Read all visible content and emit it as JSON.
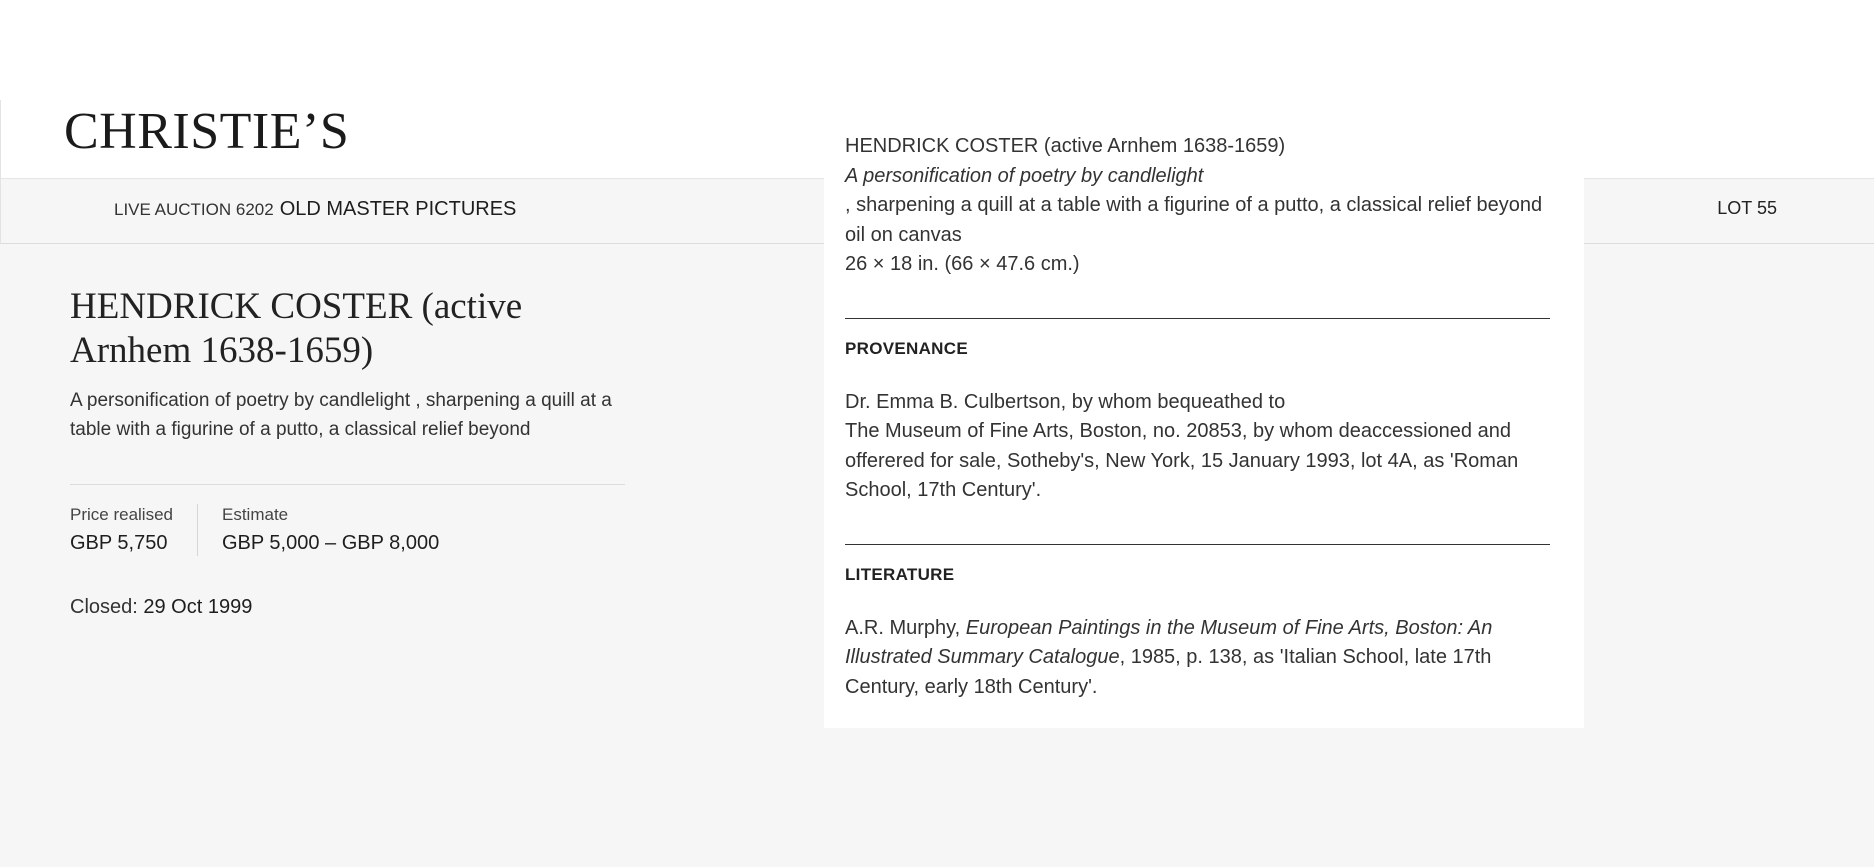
{
  "brand": {
    "logo_text": "CHRISTIE’S"
  },
  "sale": {
    "type_label": "LIVE AUCTION 6202",
    "title": "OLD MASTER PICTURES",
    "lot": "LOT 55"
  },
  "lot": {
    "artist_title": "HENDRICK COSTER (active Arnhem 1638-1659)",
    "subtitle": "A personification of poetry by candlelight , sharpening a quill at a table with a figurine of a putto, a classical relief beyond",
    "price_realised_label": "Price realised",
    "price_realised": "GBP 5,750",
    "estimate_label": "Estimate",
    "estimate": "GBP 5,000 – GBP 8,000",
    "closed_label": "Closed:",
    "closed_date": "29 Oct 1999"
  },
  "details": {
    "artist_line": "HENDRICK COSTER (active Arnhem 1638-1659)",
    "title_italic": "A personification of poetry by candlelight",
    "title_rest": ", sharpening a quill at a table with a figurine of a putto, a classical relief beyond",
    "medium": "oil on canvas",
    "dimensions": "26 × 18 in. (66 × 47.6 cm.)",
    "provenance_heading": "PROVENANCE",
    "provenance_line_1": "Dr. Emma B. Culbertson, by whom bequeathed to",
    "provenance_line_2": "The Museum of Fine Arts, Boston, no. 20853, by whom deaccessioned and offerered for sale, Sotheby's, New York, 15 January 1993, lot 4A, as 'Roman School, 17th Century'.",
    "literature_heading": "LITERATURE",
    "literature_author": "A.R. Murphy, ",
    "literature_title": "European Paintings in the Museum of Fine Arts, Boston: An Illustrated Summary Catalogue",
    "literature_rest": ", 1985, p. 138, as 'Italian School, late 17th Century, early 18th Century'."
  }
}
